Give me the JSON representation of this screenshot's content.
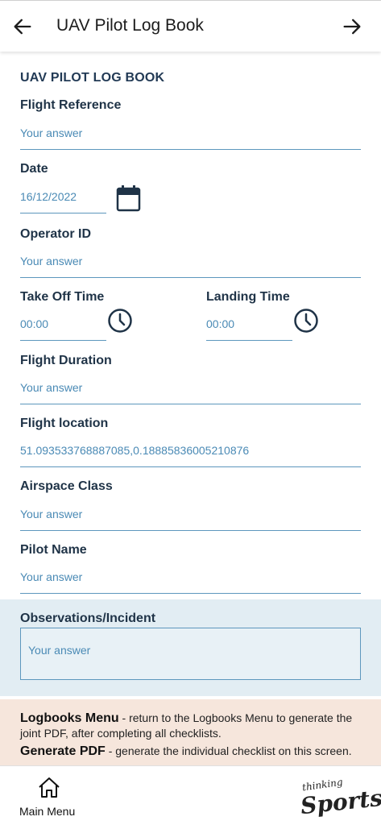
{
  "header": {
    "title": "UAV Pilot Log Book",
    "back_icon": "arrow-left-icon",
    "forward_icon": "arrow-right-icon"
  },
  "form": {
    "section_title": "UAV PILOT LOG BOOK",
    "flight_reference": {
      "label": "Flight Reference",
      "placeholder": "Your answer"
    },
    "date": {
      "label": "Date",
      "value": "16/12/2022",
      "icon": "calendar-icon"
    },
    "operator_id": {
      "label": "Operator ID",
      "placeholder": "Your answer"
    },
    "take_off_time": {
      "label": "Take Off Time",
      "value": "00:00",
      "icon": "clock-icon"
    },
    "landing_time": {
      "label": "Landing Time",
      "value": "00:00",
      "icon": "clock-icon"
    },
    "flight_duration": {
      "label": "Flight Duration",
      "placeholder": "Your answer"
    },
    "flight_location": {
      "label": "Flight location",
      "value": "51.093533768887085,0.18885836005210876"
    },
    "airspace_class": {
      "label": "Airspace Class",
      "placeholder": "Your answer"
    },
    "pilot_name": {
      "label": "Pilot Name",
      "placeholder": "Your answer"
    },
    "observations": {
      "label": "Observations/Incident",
      "placeholder": "Your answer"
    }
  },
  "info": {
    "logbooks_title": "Logbooks Menu",
    "logbooks_text": " - return to the Logbooks Menu to generate the joint PDF, after completing all checklists.",
    "pdf_title": "Generate PDF",
    "pdf_text": " - generate the individual checklist on this screen."
  },
  "bottom": {
    "main_menu_label": "Main Menu",
    "home_icon": "home-icon",
    "brand_small": "thinking",
    "brand_big": "Sports"
  },
  "colors": {
    "accent": "#5d97bd",
    "text_value": "#4a8ab5",
    "label": "#1f3347",
    "observation_bg": "#e2edf3",
    "info_bg": "#f6e6dc"
  }
}
